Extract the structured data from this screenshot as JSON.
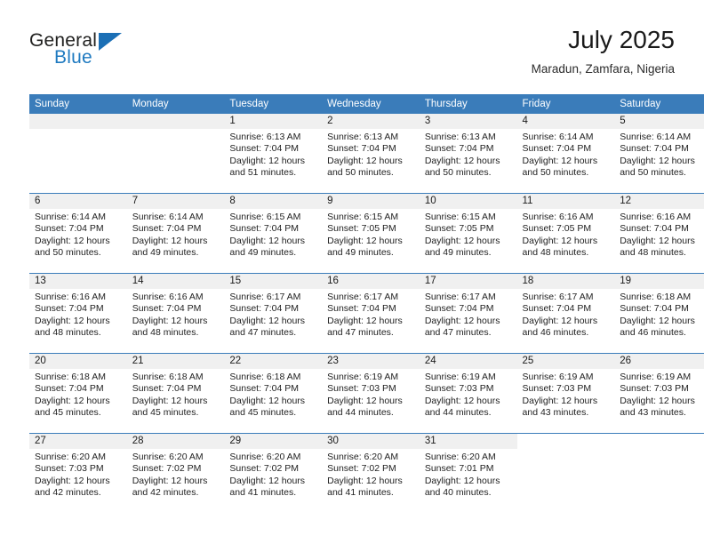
{
  "brand": {
    "name_part1": "General",
    "name_part2": "Blue",
    "triangle_color": "#1b6fb5",
    "blue_color": "#1f7ac0"
  },
  "header": {
    "title": "July 2025",
    "subtitle": "Maradun, Zamfara, Nigeria"
  },
  "theme": {
    "header_bg": "#3a7cba",
    "daynum_bg": "#f0f0f0",
    "cell_bg": "#ffffff",
    "row_line": "#3a7cba",
    "text": "#1a1a1a"
  },
  "weekday_headers": [
    "Sunday",
    "Monday",
    "Tuesday",
    "Wednesday",
    "Thursday",
    "Friday",
    "Saturday"
  ],
  "labels": {
    "sunrise_prefix": "Sunrise:",
    "sunset_prefix": "Sunset:",
    "daylight_prefix": "Daylight:"
  },
  "weeks": [
    [
      {
        "day": "",
        "empty": true
      },
      {
        "day": "",
        "empty": true
      },
      {
        "day": "1",
        "sunrise": "Sunrise: 6:13 AM",
        "sunset": "Sunset: 7:04 PM",
        "daylight_line1": "Daylight: 12 hours",
        "daylight_line2": "and 51 minutes."
      },
      {
        "day": "2",
        "sunrise": "Sunrise: 6:13 AM",
        "sunset": "Sunset: 7:04 PM",
        "daylight_line1": "Daylight: 12 hours",
        "daylight_line2": "and 50 minutes."
      },
      {
        "day": "3",
        "sunrise": "Sunrise: 6:13 AM",
        "sunset": "Sunset: 7:04 PM",
        "daylight_line1": "Daylight: 12 hours",
        "daylight_line2": "and 50 minutes."
      },
      {
        "day": "4",
        "sunrise": "Sunrise: 6:14 AM",
        "sunset": "Sunset: 7:04 PM",
        "daylight_line1": "Daylight: 12 hours",
        "daylight_line2": "and 50 minutes."
      },
      {
        "day": "5",
        "sunrise": "Sunrise: 6:14 AM",
        "sunset": "Sunset: 7:04 PM",
        "daylight_line1": "Daylight: 12 hours",
        "daylight_line2": "and 50 minutes."
      }
    ],
    [
      {
        "day": "6",
        "sunrise": "Sunrise: 6:14 AM",
        "sunset": "Sunset: 7:04 PM",
        "daylight_line1": "Daylight: 12 hours",
        "daylight_line2": "and 50 minutes."
      },
      {
        "day": "7",
        "sunrise": "Sunrise: 6:14 AM",
        "sunset": "Sunset: 7:04 PM",
        "daylight_line1": "Daylight: 12 hours",
        "daylight_line2": "and 49 minutes."
      },
      {
        "day": "8",
        "sunrise": "Sunrise: 6:15 AM",
        "sunset": "Sunset: 7:04 PM",
        "daylight_line1": "Daylight: 12 hours",
        "daylight_line2": "and 49 minutes."
      },
      {
        "day": "9",
        "sunrise": "Sunrise: 6:15 AM",
        "sunset": "Sunset: 7:05 PM",
        "daylight_line1": "Daylight: 12 hours",
        "daylight_line2": "and 49 minutes."
      },
      {
        "day": "10",
        "sunrise": "Sunrise: 6:15 AM",
        "sunset": "Sunset: 7:05 PM",
        "daylight_line1": "Daylight: 12 hours",
        "daylight_line2": "and 49 minutes."
      },
      {
        "day": "11",
        "sunrise": "Sunrise: 6:16 AM",
        "sunset": "Sunset: 7:05 PM",
        "daylight_line1": "Daylight: 12 hours",
        "daylight_line2": "and 48 minutes."
      },
      {
        "day": "12",
        "sunrise": "Sunrise: 6:16 AM",
        "sunset": "Sunset: 7:04 PM",
        "daylight_line1": "Daylight: 12 hours",
        "daylight_line2": "and 48 minutes."
      }
    ],
    [
      {
        "day": "13",
        "sunrise": "Sunrise: 6:16 AM",
        "sunset": "Sunset: 7:04 PM",
        "daylight_line1": "Daylight: 12 hours",
        "daylight_line2": "and 48 minutes."
      },
      {
        "day": "14",
        "sunrise": "Sunrise: 6:16 AM",
        "sunset": "Sunset: 7:04 PM",
        "daylight_line1": "Daylight: 12 hours",
        "daylight_line2": "and 48 minutes."
      },
      {
        "day": "15",
        "sunrise": "Sunrise: 6:17 AM",
        "sunset": "Sunset: 7:04 PM",
        "daylight_line1": "Daylight: 12 hours",
        "daylight_line2": "and 47 minutes."
      },
      {
        "day": "16",
        "sunrise": "Sunrise: 6:17 AM",
        "sunset": "Sunset: 7:04 PM",
        "daylight_line1": "Daylight: 12 hours",
        "daylight_line2": "and 47 minutes."
      },
      {
        "day": "17",
        "sunrise": "Sunrise: 6:17 AM",
        "sunset": "Sunset: 7:04 PM",
        "daylight_line1": "Daylight: 12 hours",
        "daylight_line2": "and 47 minutes."
      },
      {
        "day": "18",
        "sunrise": "Sunrise: 6:17 AM",
        "sunset": "Sunset: 7:04 PM",
        "daylight_line1": "Daylight: 12 hours",
        "daylight_line2": "and 46 minutes."
      },
      {
        "day": "19",
        "sunrise": "Sunrise: 6:18 AM",
        "sunset": "Sunset: 7:04 PM",
        "daylight_line1": "Daylight: 12 hours",
        "daylight_line2": "and 46 minutes."
      }
    ],
    [
      {
        "day": "20",
        "sunrise": "Sunrise: 6:18 AM",
        "sunset": "Sunset: 7:04 PM",
        "daylight_line1": "Daylight: 12 hours",
        "daylight_line2": "and 45 minutes."
      },
      {
        "day": "21",
        "sunrise": "Sunrise: 6:18 AM",
        "sunset": "Sunset: 7:04 PM",
        "daylight_line1": "Daylight: 12 hours",
        "daylight_line2": "and 45 minutes."
      },
      {
        "day": "22",
        "sunrise": "Sunrise: 6:18 AM",
        "sunset": "Sunset: 7:04 PM",
        "daylight_line1": "Daylight: 12 hours",
        "daylight_line2": "and 45 minutes."
      },
      {
        "day": "23",
        "sunrise": "Sunrise: 6:19 AM",
        "sunset": "Sunset: 7:03 PM",
        "daylight_line1": "Daylight: 12 hours",
        "daylight_line2": "and 44 minutes."
      },
      {
        "day": "24",
        "sunrise": "Sunrise: 6:19 AM",
        "sunset": "Sunset: 7:03 PM",
        "daylight_line1": "Daylight: 12 hours",
        "daylight_line2": "and 44 minutes."
      },
      {
        "day": "25",
        "sunrise": "Sunrise: 6:19 AM",
        "sunset": "Sunset: 7:03 PM",
        "daylight_line1": "Daylight: 12 hours",
        "daylight_line2": "and 43 minutes."
      },
      {
        "day": "26",
        "sunrise": "Sunrise: 6:19 AM",
        "sunset": "Sunset: 7:03 PM",
        "daylight_line1": "Daylight: 12 hours",
        "daylight_line2": "and 43 minutes."
      }
    ],
    [
      {
        "day": "27",
        "sunrise": "Sunrise: 6:20 AM",
        "sunset": "Sunset: 7:03 PM",
        "daylight_line1": "Daylight: 12 hours",
        "daylight_line2": "and 42 minutes."
      },
      {
        "day": "28",
        "sunrise": "Sunrise: 6:20 AM",
        "sunset": "Sunset: 7:02 PM",
        "daylight_line1": "Daylight: 12 hours",
        "daylight_line2": "and 42 minutes."
      },
      {
        "day": "29",
        "sunrise": "Sunrise: 6:20 AM",
        "sunset": "Sunset: 7:02 PM",
        "daylight_line1": "Daylight: 12 hours",
        "daylight_line2": "and 41 minutes."
      },
      {
        "day": "30",
        "sunrise": "Sunrise: 6:20 AM",
        "sunset": "Sunset: 7:02 PM",
        "daylight_line1": "Daylight: 12 hours",
        "daylight_line2": "and 41 minutes."
      },
      {
        "day": "31",
        "sunrise": "Sunrise: 6:20 AM",
        "sunset": "Sunset: 7:01 PM",
        "daylight_line1": "Daylight: 12 hours",
        "daylight_line2": "and 40 minutes."
      },
      {
        "day": "",
        "blank": true
      },
      {
        "day": "",
        "blank": true
      }
    ]
  ]
}
